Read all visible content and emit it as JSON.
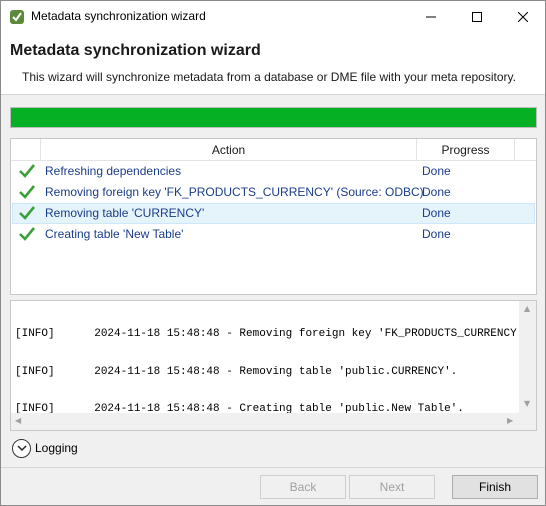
{
  "window": {
    "title": "Metadata synchronization wizard"
  },
  "header": {
    "title": "Metadata synchronization wizard",
    "subtitle": "This wizard will synchronize metadata from a database or DME file with your meta repository."
  },
  "progress": {
    "value_percent": 100,
    "color": "#06b025"
  },
  "table": {
    "columns": [
      "",
      "Action",
      "Progress"
    ],
    "rows": [
      {
        "icon": "checkmark-icon",
        "action": "Refreshing dependencies",
        "progress": "Done",
        "selected": false
      },
      {
        "icon": "checkmark-icon",
        "action": "Removing foreign key 'FK_PRODUCTS_CURRENCY' (Source: ODBC)",
        "progress": "Done",
        "selected": false
      },
      {
        "icon": "checkmark-icon",
        "action": "Removing table 'CURRENCY'",
        "progress": "Done",
        "selected": true
      },
      {
        "icon": "checkmark-icon",
        "action": "Creating table 'New Table'",
        "progress": "Done",
        "selected": false
      }
    ]
  },
  "log": {
    "lines": [
      "[INFO]      2024-11-18 15:48:48 - Removing foreign key 'FK_PRODUCTS_CURRENCY'.",
      "[INFO]      2024-11-18 15:48:48 - Removing table 'public.CURRENCY'.",
      "[INFO]      2024-11-18 15:48:48 - Creating table 'public.New Table'."
    ]
  },
  "logging": {
    "label": "Logging"
  },
  "buttons": {
    "back": "Back",
    "next": "Next",
    "finish": "Finish"
  },
  "colors": {
    "link_text": "#1a3d8a",
    "selected_row": "#e5f3fb",
    "check_green": "#3aa03a"
  }
}
